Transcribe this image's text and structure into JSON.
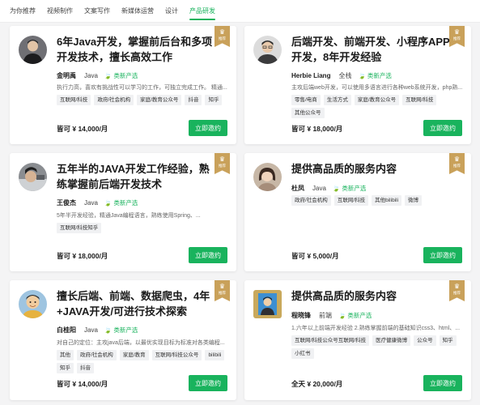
{
  "tabs": [
    "为你推荐",
    "视频制作",
    "文案写作",
    "新媒体运营",
    "设计",
    "产品研发"
  ],
  "active_tab": "产品研发",
  "badge_label": "推荐",
  "button_label": "立即邀约",
  "colors": {
    "accent": "#19b35d",
    "badge": "#c9a15a"
  },
  "cards": [
    {
      "title": "6年Java开发，掌握前后台和多项开发技术，擅长高效工作",
      "name": "金明禹",
      "role": "Java",
      "type": "🍃 类新产选",
      "desc": "执行力高，喜欢有挑战性可以学习的工作，可独立完成工作。 精通...",
      "tags": [
        "互联网/科技",
        "政府/社会机构",
        "家庭/教育公众号",
        "抖音",
        "知乎"
      ],
      "price": "皆可 ¥ 14,000/月"
    },
    {
      "title": "后端开发、前端开发、小程序APP开发，8年开发经验",
      "name": "Herbie Liang",
      "role": "全栈",
      "type": "🍃 类新产选",
      "desc": "主攻后端web开发，可以使用多语言进行各种web系统开发，php熟...",
      "tags": [
        "零售/电商",
        "生活方式",
        "家庭/教育公众号",
        "互联网/科技",
        "其他公众号"
      ],
      "price": "皆可 ¥ 18,000/月"
    },
    {
      "title": "五年半的JAVA开发工作经验，熟练掌握前后端开发技术",
      "name": "王俊杰",
      "role": "Java",
      "type": "🍃 类新产选",
      "desc": "5年半开发经验，精通Java编程语言，熟练使用Spring、...",
      "tags": [
        "互联网/科技知乎"
      ],
      "price": "皆可 ¥ 18,000/月"
    },
    {
      "title": "提供高品质的服务内容",
      "name": "杜凤",
      "role": "Java",
      "type": "🍃 类新产选",
      "desc": "",
      "tags": [
        "政府/社会机构",
        "互联网/科技",
        "其他bilibili",
        "微博"
      ],
      "price": "皆可 ¥ 5,000/月"
    },
    {
      "title": "擅长后端、前端、数据爬虫，4年+JAVA开发/可进行技术探索",
      "name": "白桂阳",
      "role": "Java",
      "type": "🍃 类新产选",
      "desc": "对自己的定位：主攻java后端，以最优实现目标为标准对各类编程...",
      "tags": [
        "其他",
        "政府/社会机构",
        "家庭/教育",
        "互联网/科技公众号",
        "bilibili",
        "知乎",
        "抖音"
      ],
      "price": "皆可 ¥ 14,000/月"
    },
    {
      "title": "提供高品质的服务内容",
      "name": "程晓锋",
      "role": "前端",
      "type": "🍃 类新产选",
      "desc": "1.六年以上前端开发经验 2.熟练掌握前端的基础知识css3、html、...",
      "tags": [
        "互联网/科技公众号互联网/科技",
        "医疗健康微博",
        "公众号",
        "知乎",
        "小红书"
      ],
      "price": "全天 ¥ 20,000/月"
    }
  ]
}
